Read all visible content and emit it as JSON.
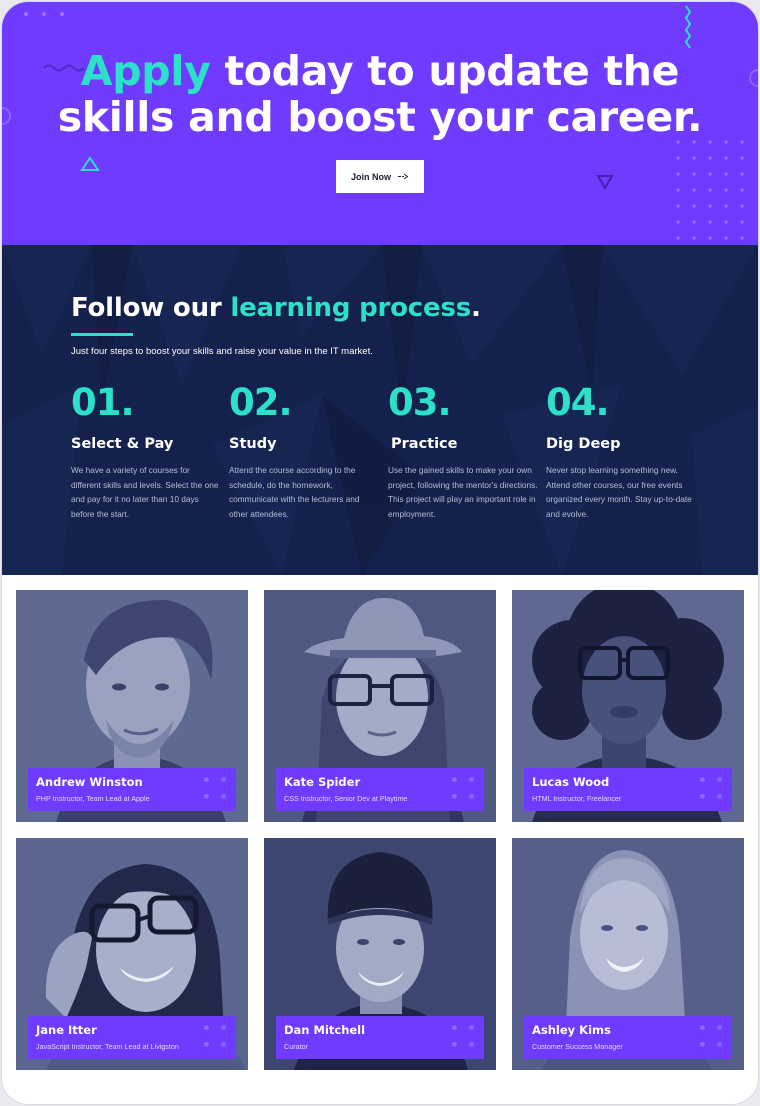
{
  "hero": {
    "title_accent": "Apply",
    "title_rest_line1": "today to update the",
    "title_line2": "skills and boost your career.",
    "button_label": "Join Now",
    "background_color": "#6f3bff",
    "accent_color": "#2de0c9"
  },
  "process": {
    "title_plain": "Follow our",
    "title_accent": "learning process",
    "title_end": ".",
    "subtitle": "Just four steps to boost your skills and raise your value in the IT market.",
    "background_color": "#14214c",
    "steps": [
      {
        "number": "01.",
        "title": "Select & Pay",
        "description": "We have a variety of courses for different skills and levels. Select the one and pay for it no later than 10 days before the start."
      },
      {
        "number": "02.",
        "title": "Study",
        "description": "Attend the course according to the schedule, do the homework, communicate with the lecturers and other attendees."
      },
      {
        "number": "03.",
        "title": "Practice",
        "description": "Use the gained skills to make your own project, following the mentor's directions. This project will play an important role in employment."
      },
      {
        "number": "04.",
        "title": "Dig Deep",
        "description": "Never stop learning something new. Attend other courses, our free events organized every month. Stay up-to-date and evolve."
      }
    ]
  },
  "team": [
    {
      "name": "Andrew Winston",
      "role": "PHP Instructor, Team Lead at Apple"
    },
    {
      "name": "Kate Spider",
      "role": "CSS Instructor, Senior Dev at Playtime"
    },
    {
      "name": "Lucas Wood",
      "role": "HTML Instructor, Freelancer"
    },
    {
      "name": "Jane Itter",
      "role": "JavaScript Instructor, Team Lead at Livigston"
    },
    {
      "name": "Dan Mitchell",
      "role": "Curator"
    },
    {
      "name": "Ashley Kims",
      "role": "Customer Success Manager"
    }
  ]
}
